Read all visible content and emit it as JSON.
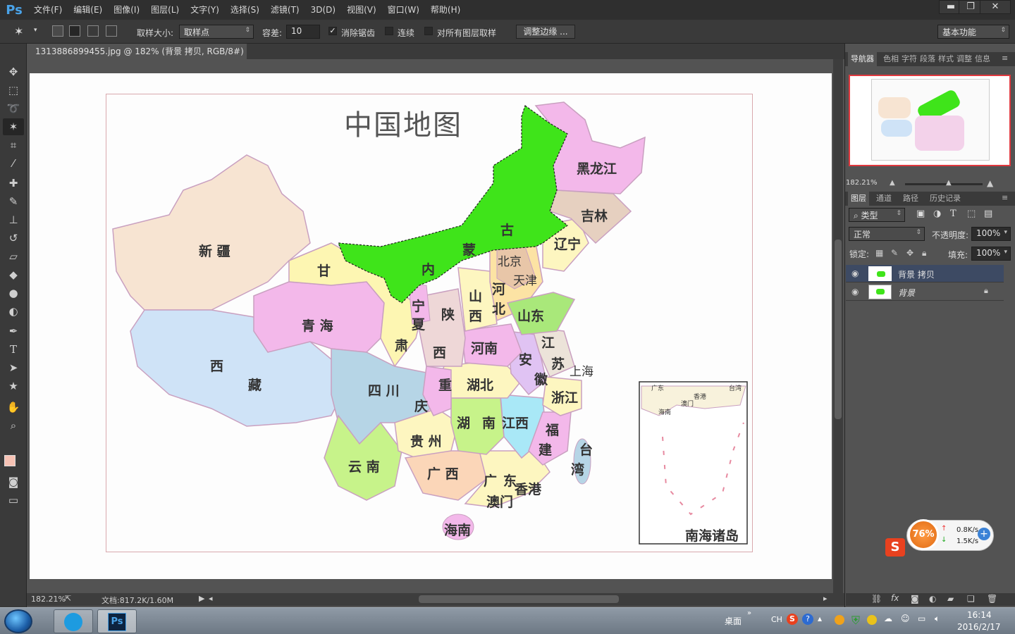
{
  "app": {
    "logo": "Ps"
  },
  "menu": [
    "文件(F)",
    "编辑(E)",
    "图像(I)",
    "图层(L)",
    "文字(Y)",
    "选择(S)",
    "滤镜(T)",
    "3D(D)",
    "视图(V)",
    "窗口(W)",
    "帮助(H)"
  ],
  "window_controls": {
    "minimize": "▬",
    "restore": "❐",
    "close": "✕"
  },
  "options": {
    "sample_size_label": "取样大小:",
    "sample_size_value": "取样点",
    "tolerance_label": "容差:",
    "tolerance_value": "10",
    "antialias_label": "消除锯齿",
    "antialias_checked": true,
    "contiguous_label": "连续",
    "contiguous_checked": false,
    "all_layers_label": "对所有图层取样",
    "all_layers_checked": false,
    "refine_edge": "调整边缘 ...",
    "workspace": "基本功能"
  },
  "document": {
    "tab_title": "1313886899455.jpg @ 182% (背景 拷贝, RGB/8#) *",
    "tab_close": "×",
    "zoom": "182.21%",
    "doc_info": "文档:817.2K/1.60M"
  },
  "map": {
    "title": "中国地图",
    "provinces": [
      "新 疆",
      "西",
      "藏",
      "青 海",
      "甘",
      "肃",
      "内",
      "蒙",
      "古",
      "黑龙江",
      "吉林",
      "辽宁",
      "北京",
      "天津",
      "河",
      "北",
      "山",
      "西",
      "宁",
      "夏",
      "陕",
      "西",
      "山东",
      "河南",
      "江",
      "苏",
      "上海",
      "安",
      "徽",
      "湖北",
      "四 川",
      "重",
      "庆",
      "湖",
      "南",
      "江西",
      "浙江",
      "福",
      "建",
      "台",
      "湾",
      "贵 州",
      "云 南",
      "广 西",
      "广",
      "东",
      "香港",
      "澳门",
      "海南"
    ],
    "inset_label": "南海诸岛",
    "inset_places": [
      "广东",
      "台湾",
      "香港",
      "澳门",
      "海南"
    ]
  },
  "panels": {
    "nav_tabs": [
      "导航器",
      "色相",
      "字符",
      "段落",
      "样式",
      "调整",
      "信息"
    ],
    "nav_zoom": "182.21%",
    "layer_tabs": [
      "图层",
      "通道",
      "路径",
      "历史记录"
    ],
    "filter_kind": "类型",
    "blend_mode": "正常",
    "opacity_label": "不透明度:",
    "opacity_value": "100%",
    "lock_label": "锁定:",
    "fill_label": "填充:",
    "fill_value": "100%",
    "layers": [
      {
        "name": "背景 拷贝",
        "selected": true,
        "locked": false
      },
      {
        "name": "背景",
        "selected": false,
        "locked": true
      }
    ]
  },
  "widget": {
    "percent": "76%",
    "up": "0.8K/s",
    "down": "1.5K/s"
  },
  "taskbar": {
    "desktop": "桌面",
    "ime": "CH",
    "time": "16:14",
    "date": "2016/2/17"
  },
  "colors": {
    "fg": "#f6c2b4",
    "bg": "#ffffff",
    "inner_mongolia": "#3fe41a"
  }
}
